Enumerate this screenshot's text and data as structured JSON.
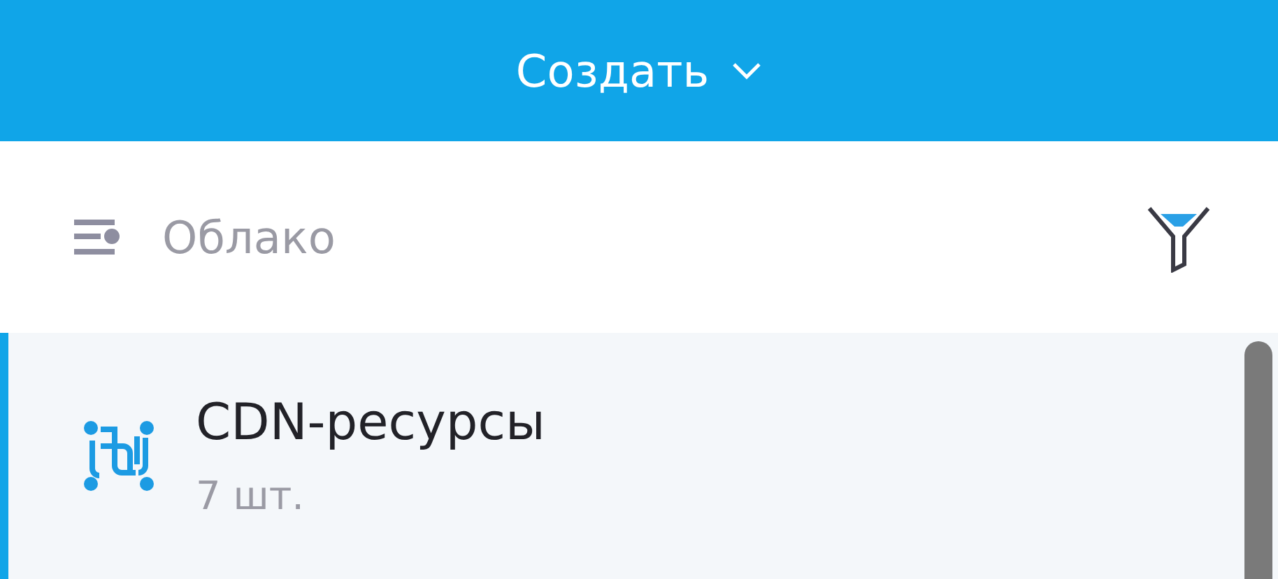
{
  "header": {
    "title": "Создать"
  },
  "toolbar": {
    "folder": "Облако"
  },
  "list": [
    {
      "title": "CDN-ресурсы",
      "count": "7 шт.",
      "selected": true
    }
  ]
}
